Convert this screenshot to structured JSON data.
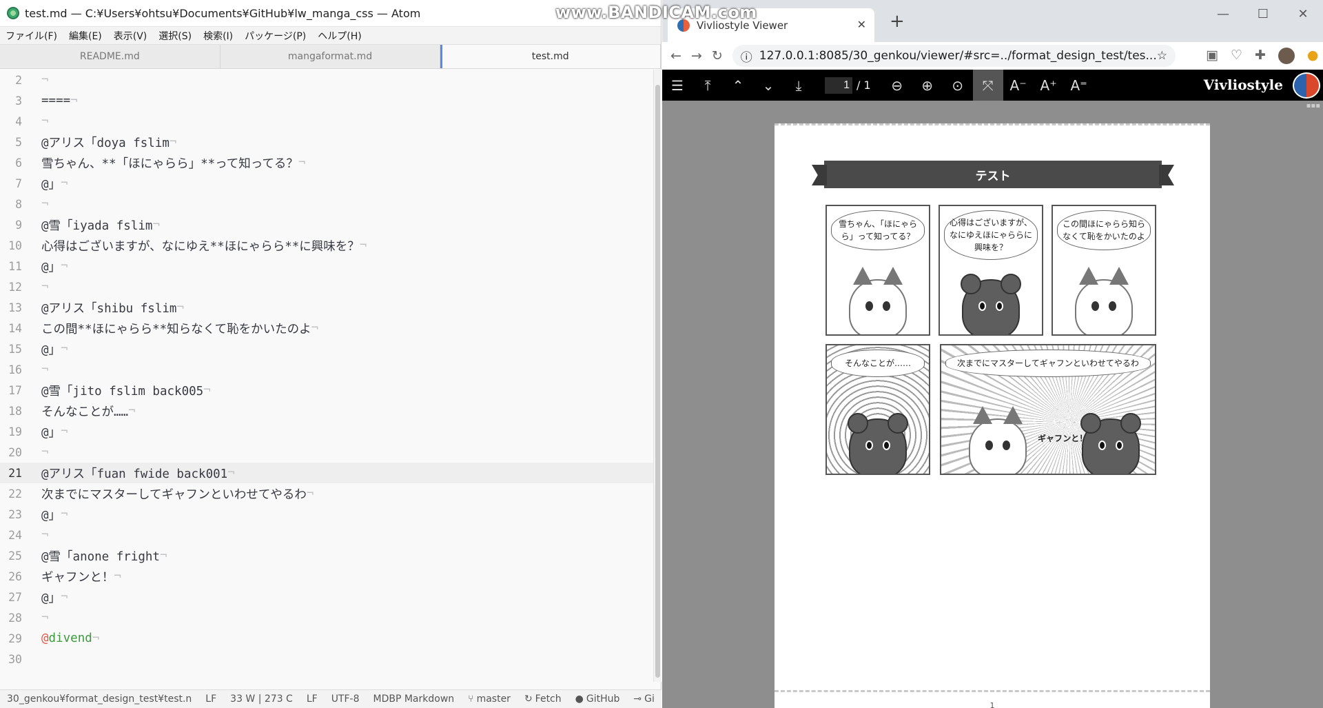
{
  "atom": {
    "title": "test.md — C:¥Users¥ohtsu¥Documents¥GitHub¥lw_manga_css — Atom",
    "menu": [
      "ファイル(F)",
      "編集(E)",
      "表示(V)",
      "選択(S)",
      "検索(I)",
      "パッケージ(P)",
      "ヘルプ(H)"
    ],
    "tabs": [
      "README.md",
      "mangaformat.md",
      "test.md"
    ],
    "lines": [
      {
        "n": "2",
        "text": ""
      },
      {
        "n": "3",
        "text": "===="
      },
      {
        "n": "4",
        "text": ""
      },
      {
        "n": "5",
        "text": "@アリス「doya fslim"
      },
      {
        "n": "6",
        "text": "雪ちゃん、**「ほにゃらら」**って知ってる？"
      },
      {
        "n": "7",
        "text": "@」"
      },
      {
        "n": "8",
        "text": ""
      },
      {
        "n": "9",
        "text": "@雪「iyada fslim"
      },
      {
        "n": "10",
        "text": "心得はございますが、なにゆえ**ほにゃらら**に興味を？"
      },
      {
        "n": "11",
        "text": "@」"
      },
      {
        "n": "12",
        "text": ""
      },
      {
        "n": "13",
        "text": "@アリス「shibu fslim"
      },
      {
        "n": "14",
        "text": "この間**ほにゃらら**知らなくて恥をかいたのよ"
      },
      {
        "n": "15",
        "text": "@」"
      },
      {
        "n": "16",
        "text": ""
      },
      {
        "n": "17",
        "text": "@雪「jito fslim back005"
      },
      {
        "n": "18",
        "text": "そんなことが……"
      },
      {
        "n": "19",
        "text": "@」"
      },
      {
        "n": "20",
        "text": ""
      },
      {
        "n": "21",
        "text": "@アリス「fuan fwide back001"
      },
      {
        "n": "22",
        "text": "次までにマスターしてギャフンといわせてやるわ"
      },
      {
        "n": "23",
        "text": "@」"
      },
      {
        "n": "24",
        "text": ""
      },
      {
        "n": "25",
        "text": "@雪「anone fright"
      },
      {
        "n": "26",
        "text": "ギャフンと！"
      },
      {
        "n": "27",
        "text": "@」"
      },
      {
        "n": "28",
        "text": ""
      },
      {
        "n": "29",
        "text": "@divend"
      },
      {
        "n": "30",
        "text": ""
      }
    ],
    "eol": "¬",
    "status": {
      "path": "30_genkou¥format_design_test¥test.n",
      "lf1": "LF",
      "counts": "33 W | 273 C",
      "lf2": "LF",
      "encoding": "UTF-8",
      "grammar": "MDBP Markdown",
      "branch": "master",
      "fetch": "Fetch",
      "github": "GitHub",
      "git": "Gi"
    }
  },
  "watermark": "www.BANDICAM.com",
  "browser": {
    "tab_title": "Vivliostyle Viewer",
    "url": "127.0.0.1:8085/30_genkou/viewer/#src=../format_design_test/tes...",
    "page_current": "1",
    "page_total": "/ 1",
    "brand": "Vivliostyle",
    "page": {
      "heading": "テスト",
      "panel1": "雪ちゃん、「ほにゃら\nら」って知ってる？",
      "panel2": "心得はございますが、\nなにゆえほにゃららに\n興味を？",
      "panel3": "この間ほにゃらら知ら\nなくて恥をかいたのよ",
      "panel4": "そんなことが……",
      "panel5": "次までにマスターしてギャフンといわせてやるわ",
      "panel5_aside": "ギャフンと！",
      "page_number": "1"
    }
  },
  "colors": {
    "accent": "#568af2",
    "at_symbol": "#e45649",
    "keyword": "#3c9a3c"
  }
}
